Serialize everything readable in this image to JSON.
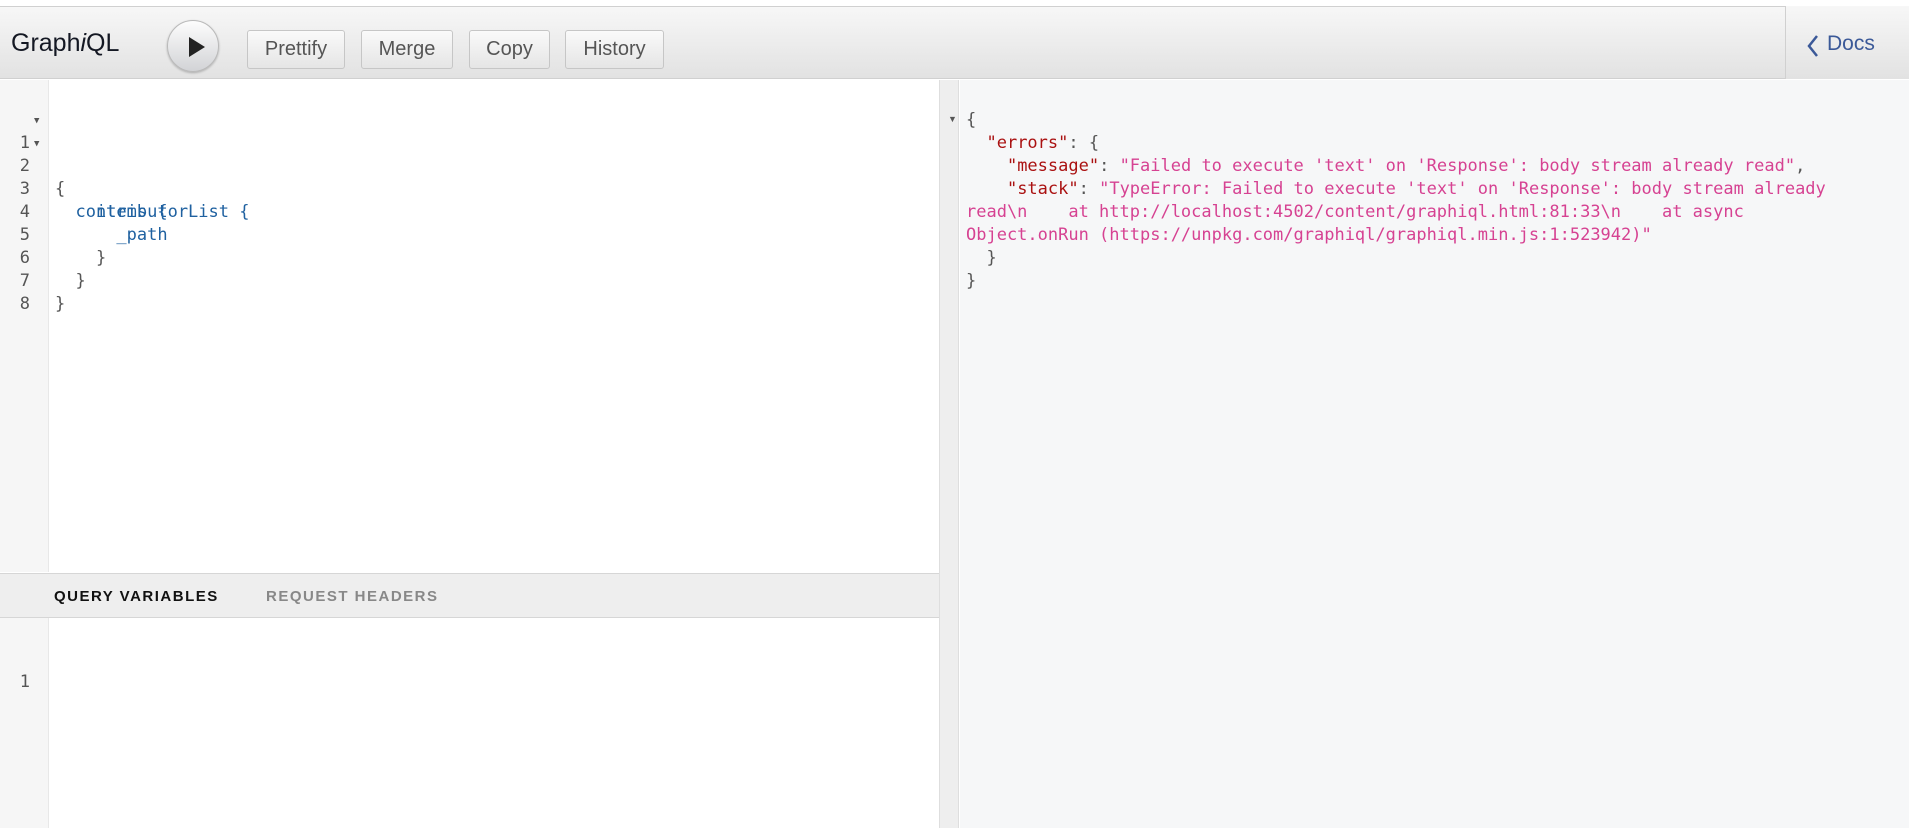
{
  "toolbar": {
    "title_prefix": "Graph",
    "title_italic": "i",
    "title_suffix": "QL",
    "buttons": [
      "Prettify",
      "Merge",
      "Copy",
      "History"
    ],
    "docs_label": "Docs"
  },
  "query_editor": {
    "line_numbers": [
      "1",
      "2",
      "3",
      "4",
      "5",
      "6",
      "7",
      "8"
    ],
    "lines": [
      "{",
      "  contributorList {",
      "    items {",
      "      _path",
      "    }",
      "  }",
      "}",
      ""
    ]
  },
  "variables_panel": {
    "tabs": [
      "QUERY VARIABLES",
      "REQUEST HEADERS"
    ],
    "active_tab": "QUERY VARIABLES",
    "line_numbers": [
      "1"
    ]
  },
  "result": {
    "open_brace": "{",
    "errors_key": "\"errors\"",
    "errors_open": ": {",
    "message_key": "\"message\"",
    "message_value": "\"Failed to execute 'text' on 'Response': body stream already read\"",
    "stack_key": "\"stack\"",
    "stack_value_line1": "\"TypeError: Failed to execute 'text' on 'Response': body stream already",
    "stack_value_line2": "read\\n    at http://localhost:4502/content/graphiql.html:81:33\\n    at async",
    "stack_value_line3": "Object.onRun (https://unpkg.com/graphiql/graphiql.min.js:1:523942)\"",
    "inner_close": "}",
    "close_brace": "}"
  },
  "colors": {
    "field": "#1f61a0",
    "json_key": "#a11",
    "json_string": "#d64292",
    "docs_link": "#3b5998"
  }
}
